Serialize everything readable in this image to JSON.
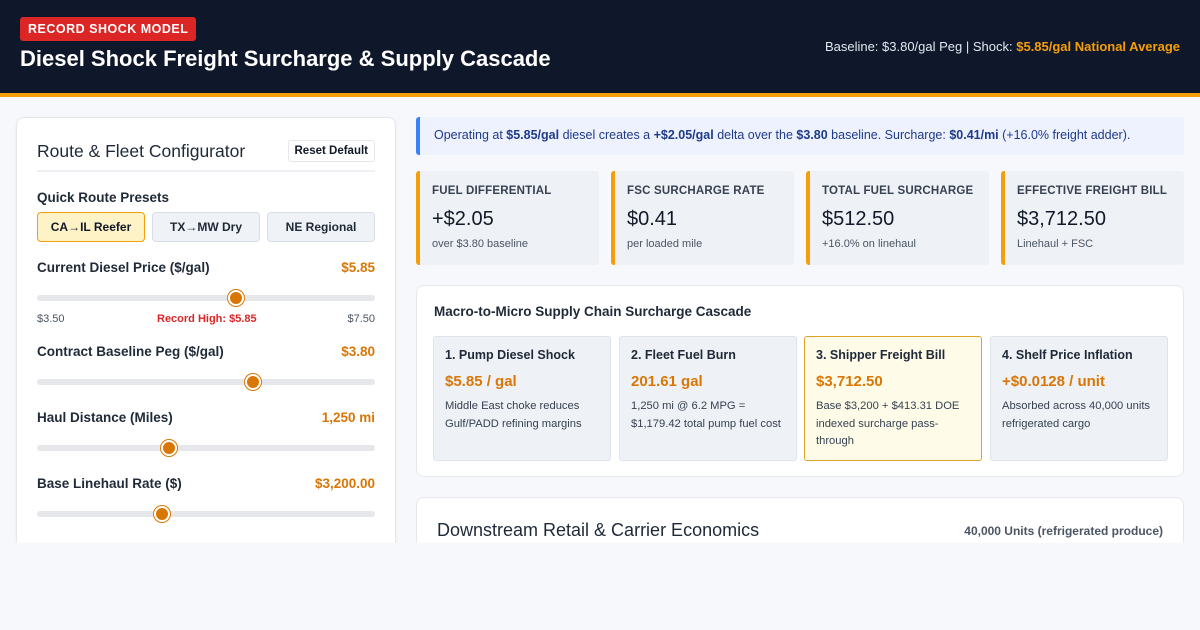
{
  "header": {
    "badge": "RECORD SHOCK MODEL",
    "title": "Diesel Shock Freight Surcharge & Supply Cascade",
    "meta_prefix": "Baseline: $3.80/gal Peg | Shock: ",
    "meta_highlight": "$5.85/gal National Average"
  },
  "configurator": {
    "title": "Route & Fleet Configurator",
    "reset_label": "Reset Default",
    "presets_label": "Quick Route Presets",
    "presets": [
      {
        "label": "CA→IL Reefer",
        "active": true
      },
      {
        "label": "TX→MW Dry",
        "active": false
      },
      {
        "label": "NE Regional",
        "active": false
      }
    ],
    "diesel": {
      "label": "Current Diesel Price ($/gal)",
      "value": "$5.85",
      "level": 0.59,
      "min_label": "$3.50",
      "max_label": "$7.50",
      "record_label": "Record High: $5.85"
    },
    "peg": {
      "label": "Contract Baseline Peg ($/gal)",
      "value": "$3.80",
      "level": 0.64
    },
    "distance": {
      "label": "Haul Distance (Miles)",
      "value": "1,250 mi",
      "level": 0.39
    },
    "linehaul": {
      "label": "Base Linehaul Rate ($)",
      "value": "$3,200.00",
      "level": 0.37
    }
  },
  "banner": {
    "t1": "Operating at ",
    "b1": "$5.85/gal",
    "t2": " diesel creates a ",
    "b2": "+$2.05/gal",
    "t3": " delta over the ",
    "b3": "$3.80",
    "t4": " baseline. Surcharge: ",
    "b4": "$0.41/mi",
    "t5": " (+16.0% freight adder)."
  },
  "kpis": [
    {
      "label": "FUEL DIFFERENTIAL",
      "value": "+$2.05",
      "sub": "over $3.80 baseline"
    },
    {
      "label": "FSC SURCHARGE RATE",
      "value": "$0.41",
      "sub": "per loaded mile"
    },
    {
      "label": "TOTAL FUEL SURCHARGE",
      "value": "$512.50",
      "sub": "+16.0% on linehaul"
    },
    {
      "label": "EFFECTIVE FREIGHT BILL",
      "value": "$3,712.50",
      "sub": "Linehaul + FSC"
    }
  ],
  "cascade": {
    "title": "Macro-to-Micro Supply Chain Surcharge Cascade",
    "steps": [
      {
        "title": "1. Pump Diesel Shock",
        "value": "$5.85 / gal",
        "desc": "Middle East choke reduces Gulf/PADD refining margins"
      },
      {
        "title": "2. Fleet Fuel Burn",
        "value": "201.61 gal",
        "desc": "1,250 mi @ 6.2 MPG = $1,179.42 total pump fuel cost"
      },
      {
        "title": "3. Shipper Freight Bill",
        "value": "$3,712.50",
        "desc": "Base $3,200 + $413.31 DOE indexed surcharge pass-through"
      },
      {
        "title": "4. Shelf Price Inflation",
        "value": "+$0.0128 / unit",
        "desc": "Absorbed across 40,000 units refrigerated cargo"
      }
    ]
  },
  "downstream": {
    "title": "Downstream Retail & Carrier Economics",
    "meta": "40,000 Units (refrigerated produce)"
  },
  "colors": {
    "accent": "#d97706",
    "header_bg": "#0f172a",
    "badge": "#dc2626",
    "banner_accent": "#3b82f6"
  }
}
